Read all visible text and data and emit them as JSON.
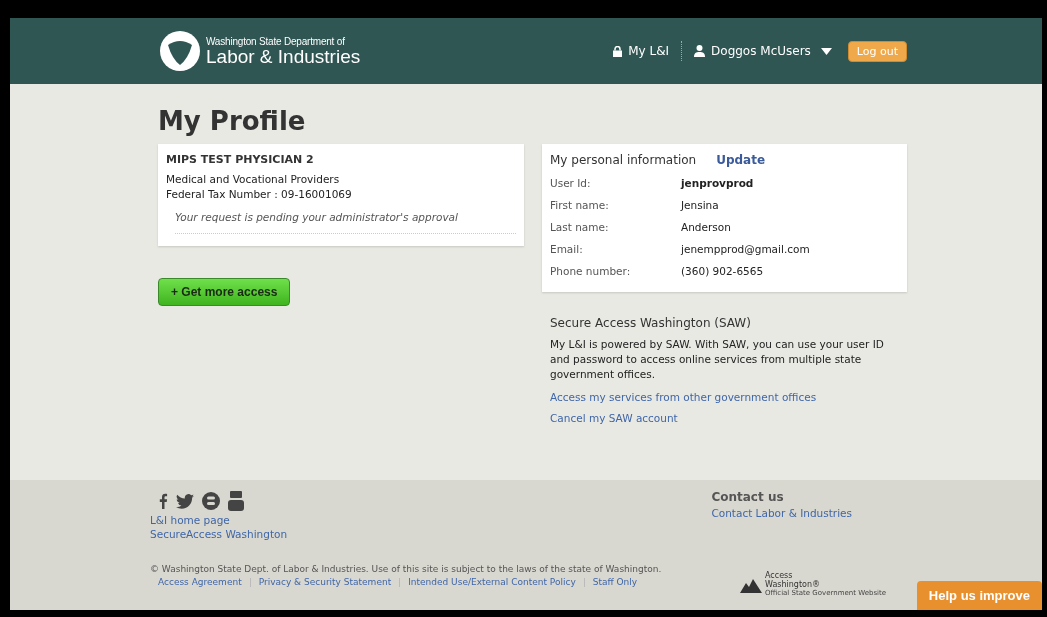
{
  "header": {
    "org_line": "Washington State Department of",
    "org_name": "Labor & Industries",
    "my_li": "My L&I",
    "user": "Doggos McUsers",
    "logout": "Log out"
  },
  "page_title": "My Profile",
  "account": {
    "name": "MIPS TEST PHYSICIAN 2",
    "type": "Medical and Vocational Providers",
    "tax": "Federal Tax Number : 09-16001069",
    "status": "Your request is pending your administrator's approval"
  },
  "more_access": "+ Get more access",
  "personal": {
    "title": "My personal information",
    "update": "Update",
    "fields": [
      {
        "label": "User Id:",
        "value": "jenprovprod",
        "bold": true
      },
      {
        "label": "First name:",
        "value": "Jensina",
        "bold": false
      },
      {
        "label": "Last name:",
        "value": "Anderson",
        "bold": false
      },
      {
        "label": "Email:",
        "value": "jenempprod@gmail.com",
        "bold": false
      },
      {
        "label": "Phone number:",
        "value": "(360) 902-6565",
        "bold": false
      }
    ]
  },
  "saw": {
    "title": "Secure Access Washington (SAW)",
    "text": "My L&I is powered by SAW. With SAW, you can use your user ID and password to access online services from multiple state government offices.",
    "links": [
      "Access my services from other government offices",
      "Cancel my SAW account"
    ]
  },
  "footer": {
    "links": [
      "L&I home page",
      "SecureAccess Washington"
    ],
    "contact_title": "Contact us",
    "contact_link": "Contact Labor & Industries",
    "copyright": "© Washington State Dept. of Labor & Industries. Use of this site is subject to the laws of the state of Washington.",
    "bottom_links": [
      "Access Agreement",
      "Privacy & Security Statement",
      "Intended Use/External Content Policy",
      "Staff Only"
    ],
    "aw_line1": "Access",
    "aw_line2": "Washington®",
    "aw_tag": "Official State Government Website",
    "help": "Help us improve"
  }
}
